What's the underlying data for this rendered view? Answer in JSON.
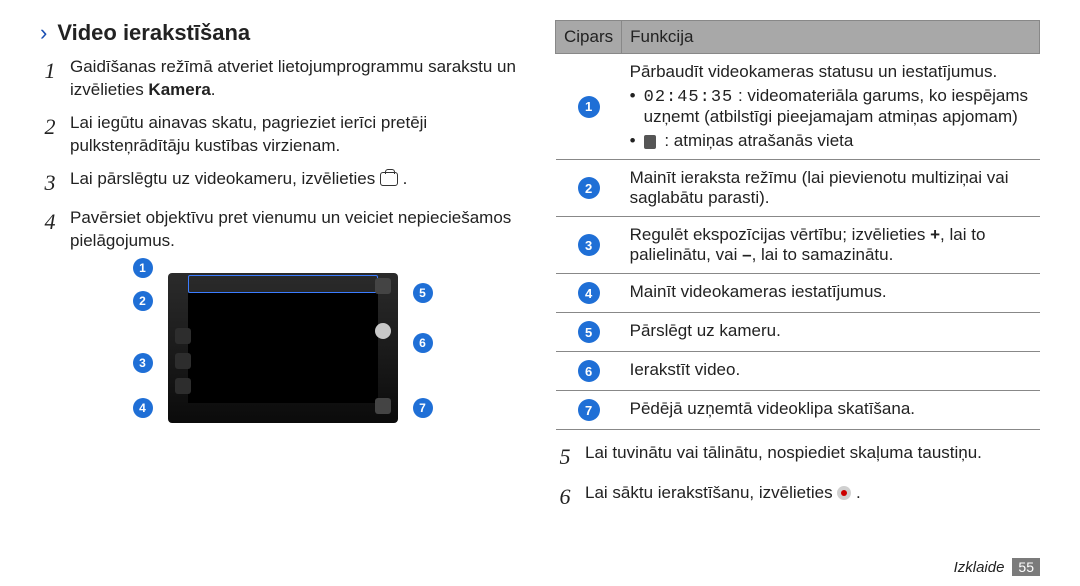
{
  "heading": {
    "arrow": "›",
    "title": "Video ierakstīšana"
  },
  "steps": {
    "s1": {
      "num": "1",
      "txt": "Gaidīšanas režīmā atveriet lietojumprogrammu sarakstu un izvēlieties Kamera."
    },
    "s2": {
      "num": "2",
      "txt": "Lai iegūtu ainavas skatu, pagrieziet ierīci pretēji pulksteņrādītāju kustības virzienam."
    },
    "s3": {
      "num": "3",
      "txt": "Lai pārslēgtu uz videokameru, izvēlieties "
    },
    "s4": {
      "num": "4",
      "txt": "Pavērsiet objektīvu pret vienumu un veiciet nepieciešamos pielāgojumus."
    },
    "s5": {
      "num": "5",
      "txt": "Lai tuvinātu vai tālinātu, nospiediet skaļuma taustiņu."
    },
    "s6": {
      "num": "6",
      "txt": "Lai sāktu ierakstīšanu, izvēlieties "
    }
  },
  "callouts": {
    "c1": "1",
    "c2": "2",
    "c3": "3",
    "c4": "4",
    "c5": "5",
    "c6": "6",
    "c7": "7"
  },
  "table": {
    "header_num": "Cipars",
    "header_fn": "Funkcija",
    "r1_main": "Pārbaudīt videokameras statusu un iestatījumus.",
    "r1_b1_time": "02:45:35",
    "r1_b1_rest": " : videomateriāla garums, ko iespējams uzņemt (atbilstīgi pieejamajam atmiņas apjomam)",
    "r1_b2": " : atmiņas atrašanās vieta",
    "r2": "Mainīt ieraksta režīmu (lai pievienotu multiziņai vai saglabātu parasti).",
    "r3": "Regulēt ekspozīcijas vērtību; izvēlieties +, lai to palielinātu, vai –, lai to samazinātu.",
    "r4": "Mainīt videokameras iestatījumus.",
    "r5": "Pārslēgt uz kameru.",
    "r6": "Ierakstīt video.",
    "r7": "Pēdējā uzņemtā videoklipa skatīšana."
  },
  "footer": {
    "label": "Izklaide",
    "page": "55"
  }
}
